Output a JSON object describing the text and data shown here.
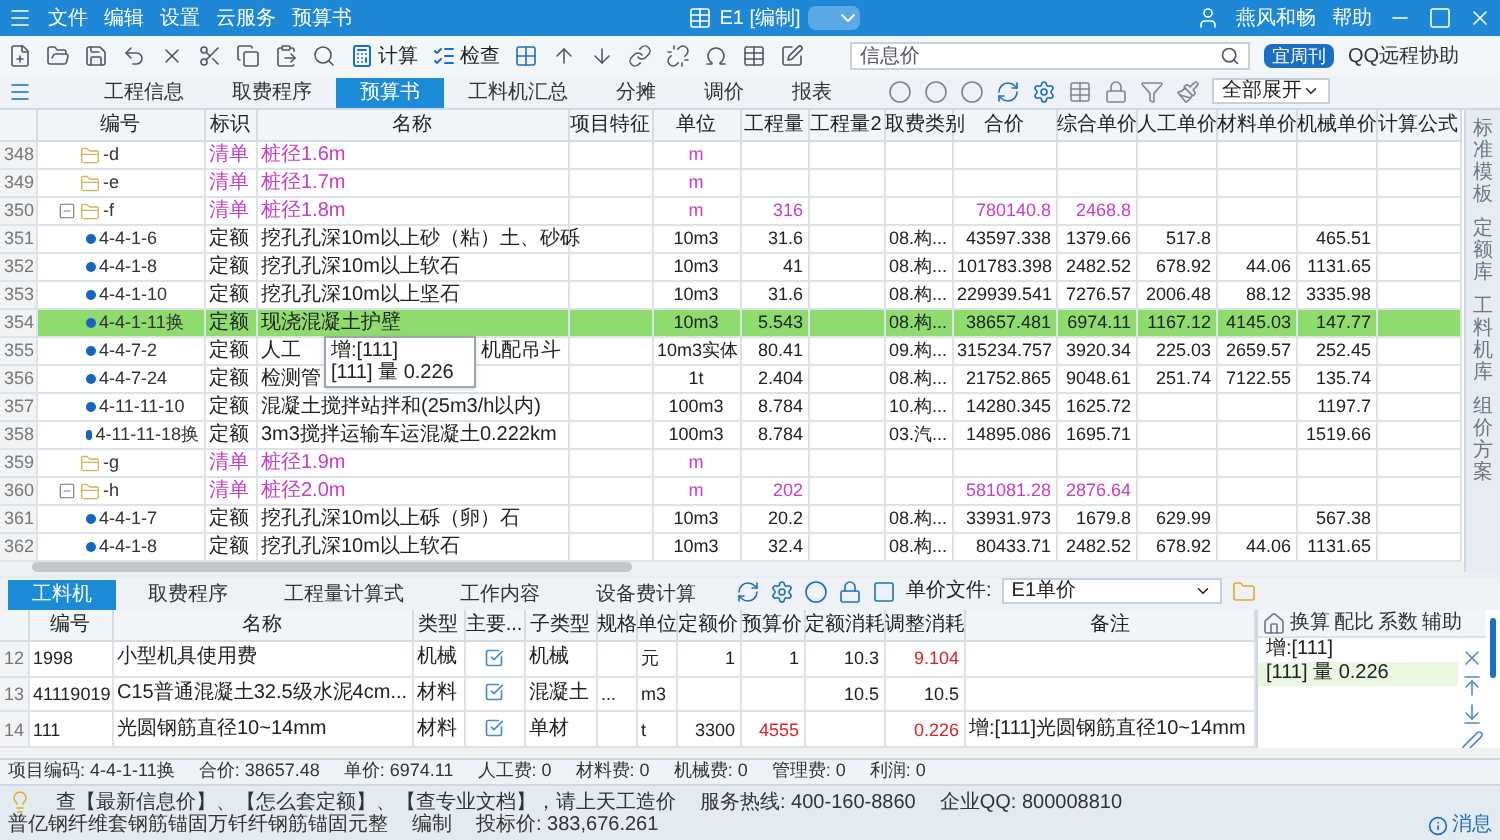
{
  "window": {
    "menu": [
      "文件",
      "编辑",
      "设置",
      "云服务",
      "预算书"
    ],
    "document": "E1 [编制]",
    "user": "燕风和畅",
    "help": "帮助"
  },
  "toolbar": {
    "buttons": [
      "计算",
      "检查"
    ],
    "search": {
      "value": "信息价"
    },
    "weekly": "宜周刊",
    "remote": "QQ远程协助"
  },
  "tabs": [
    {
      "label": "工程信息",
      "selected": false
    },
    {
      "label": "取费程序",
      "selected": false
    },
    {
      "label": "预算书",
      "selected": true
    },
    {
      "label": "工料机汇总",
      "selected": false
    },
    {
      "label": "分摊",
      "selected": false
    },
    {
      "label": "调价",
      "selected": false
    },
    {
      "label": "报表",
      "selected": false
    }
  ],
  "expand_select": {
    "value": "全部展开"
  },
  "table": {
    "columns": [
      "编号",
      "标识",
      "名称",
      "项目特征",
      "单位",
      "工程量",
      "工程量2",
      "取费类别",
      "合价",
      "综合单价",
      "人工单价",
      "材料单价",
      "机械单价",
      "计算公式"
    ],
    "rows": [
      {
        "no": "348",
        "code": "-d",
        "mark": "清单",
        "name": "桩径1.6m",
        "unit": "m",
        "expanded": false,
        "selected": false
      },
      {
        "no": "349",
        "code": "-e",
        "mark": "清单",
        "name": "桩径1.7m",
        "unit": "m",
        "expanded": false,
        "selected": false
      },
      {
        "no": "350",
        "code": "-f",
        "mark": "清单",
        "name": "桩径1.8m",
        "unit": "m",
        "qty": "316",
        "total": "780140.8",
        "unit_price": "2468.8",
        "expanded": true,
        "selected": false,
        "children": [
          {
            "no": "351",
            "code": "4-4-1-6",
            "mark": "定额",
            "name": "挖孔孔深10m以上砂（粘）土、砂砾",
            "unit": "10m3",
            "qty": "31.6",
            "fee": "08.构...",
            "total": "43597.338",
            "unit_price": "1379.66",
            "labor": "517.8",
            "machine": "465.51",
            "selected": false
          },
          {
            "no": "352",
            "code": "4-4-1-8",
            "mark": "定额",
            "name": "挖孔孔深10m以上软石",
            "unit": "10m3",
            "qty": "41",
            "fee": "08.构...",
            "total": "101783.398",
            "unit_price": "2482.52",
            "labor": "678.92",
            "material": "44.06",
            "machine": "1131.65",
            "selected": false
          },
          {
            "no": "353",
            "code": "4-4-1-10",
            "mark": "定额",
            "name": "挖孔孔深10m以上坚石",
            "unit": "10m3",
            "qty": "31.6",
            "fee": "08.构...",
            "total": "229939.541",
            "unit_price": "7276.57",
            "labor": "2006.48",
            "material": "88.12",
            "machine": "3335.98",
            "selected": false
          },
          {
            "no": "354",
            "code": "4-4-1-11换",
            "mark": "定额",
            "name": "现浇混凝土护壁",
            "unit": "10m3",
            "qty": "5.543",
            "fee": "08.构...",
            "total": "38657.481",
            "unit_price": "6974.11",
            "labor": "1167.12",
            "material": "4145.03",
            "machine": "147.77",
            "selected": true
          },
          {
            "no": "355",
            "code": "4-4-7-2",
            "mark": "定额",
            "name": "人工",
            "name_after_tooltip": "机配吊斗",
            "tooltip": [
              "增:[111]",
              "[111] 量 0.226"
            ],
            "unit": "10m3实体",
            "qty": "80.41",
            "fee": "09.构...",
            "total": "315234.757",
            "unit_price": "3920.34",
            "labor": "225.03",
            "material": "2659.57",
            "machine": "252.45",
            "selected": false
          },
          {
            "no": "356",
            "code": "4-4-7-24",
            "mark": "定额",
            "name": "检测管",
            "unit": "1t",
            "qty": "2.404",
            "fee": "08.构...",
            "total": "21752.865",
            "unit_price": "9048.61",
            "labor": "251.74",
            "material": "7122.55",
            "machine": "135.74",
            "selected": false
          },
          {
            "no": "357",
            "code": "4-11-11-10",
            "mark": "定额",
            "name": "混凝土搅拌站拌和(25m3/h以内)",
            "unit": "100m3",
            "qty": "8.784",
            "fee": "10.构...",
            "total": "14280.345",
            "unit_price": "1625.72",
            "machine": "1197.7",
            "selected": false
          },
          {
            "no": "358",
            "code": "4-11-11-18换",
            "mark": "定额",
            "name": "3m3搅拌运输车运混凝土0.222km",
            "unit": "100m3",
            "qty": "8.784",
            "fee": "03.汽...",
            "total": "14895.086",
            "unit_price": "1695.71",
            "machine": "1519.66",
            "selected": false
          }
        ]
      },
      {
        "no": "359",
        "code": "-g",
        "mark": "清单",
        "name": "桩径1.9m",
        "unit": "m",
        "expanded": false,
        "selected": false
      },
      {
        "no": "360",
        "code": "-h",
        "mark": "清单",
        "name": "桩径2.0m",
        "unit": "m",
        "qty": "202",
        "total": "581081.28",
        "unit_price": "2876.64",
        "expanded": true,
        "selected": false,
        "children": [
          {
            "no": "361",
            "code": "4-4-1-7",
            "mark": "定额",
            "name": "挖孔孔深10m以上砾（卵）石",
            "unit": "10m3",
            "qty": "20.2",
            "fee": "08.构...",
            "total": "33931.973",
            "unit_price": "1679.8",
            "labor": "629.99",
            "machine": "567.38",
            "selected": false
          },
          {
            "no": "362",
            "code": "4-4-1-8",
            "mark": "定额",
            "name": "挖孔孔深10m以上软石",
            "unit": "10m3",
            "qty": "32.4",
            "fee": "08.构...",
            "total": "80433.71",
            "unit_price": "2482.52",
            "labor": "678.92",
            "material": "44.06",
            "machine": "1131.65",
            "selected": false
          }
        ]
      }
    ]
  },
  "side_tabs": [
    "标准模板",
    "定额库",
    "工料机库",
    "组价方案"
  ],
  "detail": {
    "tabs": [
      {
        "label": "工料机",
        "selected": true
      },
      {
        "label": "取费程序",
        "selected": false
      },
      {
        "label": "工程量计算式",
        "selected": false
      },
      {
        "label": "工作内容",
        "selected": false
      },
      {
        "label": "设备费计算",
        "selected": false
      }
    ],
    "price_file": {
      "label": "单价文件:",
      "value": "E1单价"
    },
    "columns": [
      "编号",
      "名称",
      "类型",
      "主要...",
      "子类型",
      "规格",
      "单位",
      "定额价",
      "预算价",
      "定额消耗",
      "调整消耗",
      "备注"
    ],
    "rows": [
      {
        "no": "12",
        "code": "1998",
        "name": "小型机具使用费",
        "type": "机械",
        "main": true,
        "subtype": "机械",
        "spec": "",
        "unit": "元",
        "base_price": "1",
        "price": "1",
        "price_changed": false,
        "base_use": "10.3",
        "use": "9.104",
        "use_changed": true,
        "note": ""
      },
      {
        "no": "13",
        "code": "41119019",
        "name": "C15普通混凝土32.5级水泥4cm...",
        "type": "材料",
        "main": true,
        "subtype": "混凝土",
        "spec": "...",
        "unit": "m3",
        "base_price": "",
        "price": "",
        "base_use": "10.5",
        "use": "10.5",
        "use_changed": false,
        "note": ""
      },
      {
        "no": "14",
        "code": "111",
        "name": "光圆钢筋直径10~14mm",
        "type": "材料",
        "main": true,
        "subtype": "单材",
        "spec": "",
        "unit": "t",
        "base_price": "3300",
        "price": "4555",
        "price_changed": true,
        "base_use": "",
        "use": "0.226",
        "use_changed": true,
        "note": "增:[111]光圆钢筋直径10~14mm"
      }
    ]
  },
  "adjust_panel": {
    "tabs": [
      {
        "label": "换算",
        "selected": false
      },
      {
        "label": "配比",
        "selected": false
      },
      {
        "label": "系数",
        "selected": false
      },
      {
        "label": "辅助",
        "selected": false
      }
    ],
    "lines": [
      {
        "text": "增:[111]",
        "selected": false
      },
      {
        "text": "[111] 量 0.226",
        "selected": true
      }
    ]
  },
  "summary": [
    "项目编码: 4-4-1-11换",
    "合价: 38657.48",
    "单价: 6974.11",
    "人工费: 0",
    "材料费: 0",
    "机械费: 0",
    "管理费: 0",
    "利润: 0"
  ],
  "status_bar": {
    "hint": "查【最新信息价】、【怎么套定额】、【查专业文档】，请上天工造价",
    "hotline": "服务热线: 400-160-8860",
    "qq": "企业QQ: 800008810",
    "ticker": "普亿钢纤维套钢筋锚固万钎纤钢筋锚固元整",
    "mode": "编制",
    "bid": "投标价: 383,676.261",
    "messages": "消息"
  }
}
